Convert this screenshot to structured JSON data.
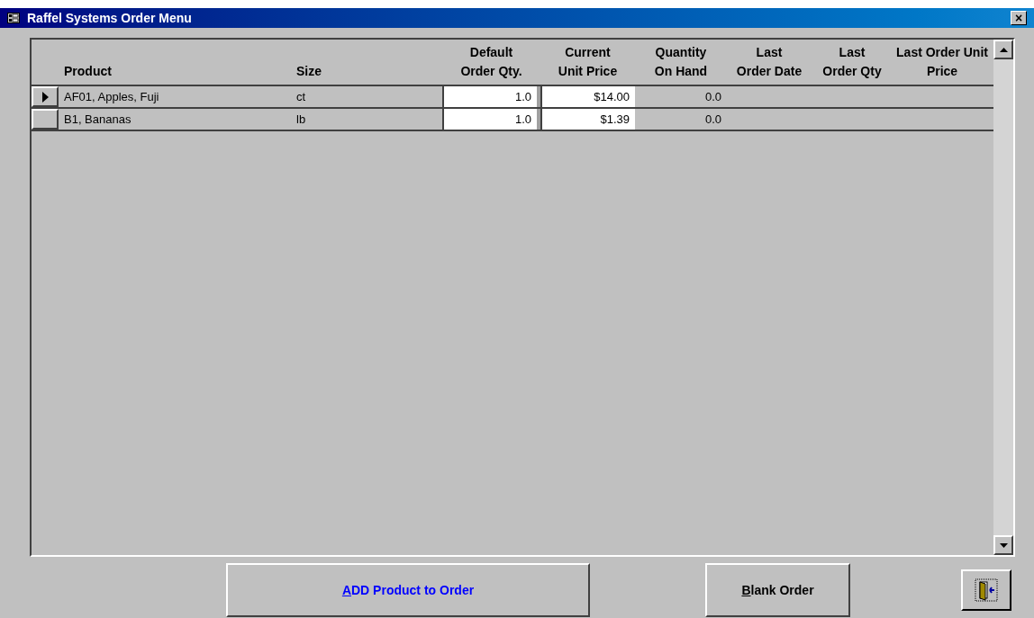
{
  "window": {
    "title": "Raffel Systems Order Menu",
    "close": "×"
  },
  "table": {
    "columns": [
      "Product",
      "Size",
      "Default Order Qty.",
      "Current Unit Price",
      "Quantity On Hand",
      "Last Order Date",
      "Last Order Qty",
      "Last Order Unit Price"
    ],
    "rows": [
      {
        "selected": true,
        "product": "AF01, Apples, Fuji",
        "size": "ct",
        "default_qty": "1.0",
        "unit_price": "$14.00",
        "on_hand": "0.0"
      },
      {
        "selected": false,
        "product": "B1, Bananas",
        "size": "lb",
        "default_qty": "1.0",
        "unit_price": "$1.39",
        "on_hand": "0.0"
      }
    ]
  },
  "buttons": [
    {
      "kind": "link",
      "label": "ADD Product to Order"
    },
    {
      "kind": "plain",
      "label": "Blank Order"
    },
    {
      "kind": "exit"
    }
  ]
}
